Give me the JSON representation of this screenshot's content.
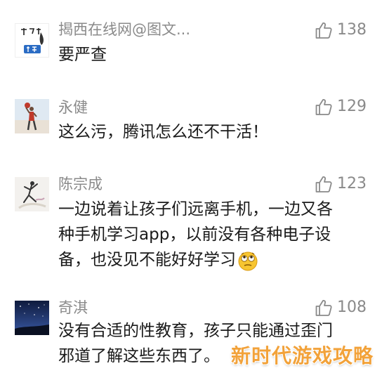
{
  "comments": [
    {
      "username": "揭西在线网@图文...",
      "likes": "138",
      "lines": [
        "要严查"
      ],
      "avatar": "calligraphy-badge-avatar"
    },
    {
      "username": "永健",
      "likes": "129",
      "lines": [
        "这么污，腾讯怎么还不干活！"
      ],
      "avatar": "basketball-player-avatar"
    },
    {
      "username": "陈宗成",
      "likes": "123",
      "lines": [
        "一边说着让孩子们远离手机，一边又各",
        "种手机学习app，以前没有各种电子设",
        "备，也没见不能好好学习"
      ],
      "avatar": "dancer-avatar",
      "emoji": "rolling-eyes-emoji"
    },
    {
      "username": "奇淇",
      "likes": "108",
      "lines": [
        "没有合适的性教育，孩子只能通过歪门",
        "邪道了解这些东西了。"
      ],
      "avatar": "night-sky-avatar"
    }
  ],
  "watermark": "新时代游戏攻略",
  "colors": {
    "username": "#8a8a8a",
    "text": "#1a1a1a",
    "like_icon": "#8a8a8a",
    "watermark": "#f2a23a"
  },
  "icons": {
    "like": "thumbs-up-icon"
  }
}
